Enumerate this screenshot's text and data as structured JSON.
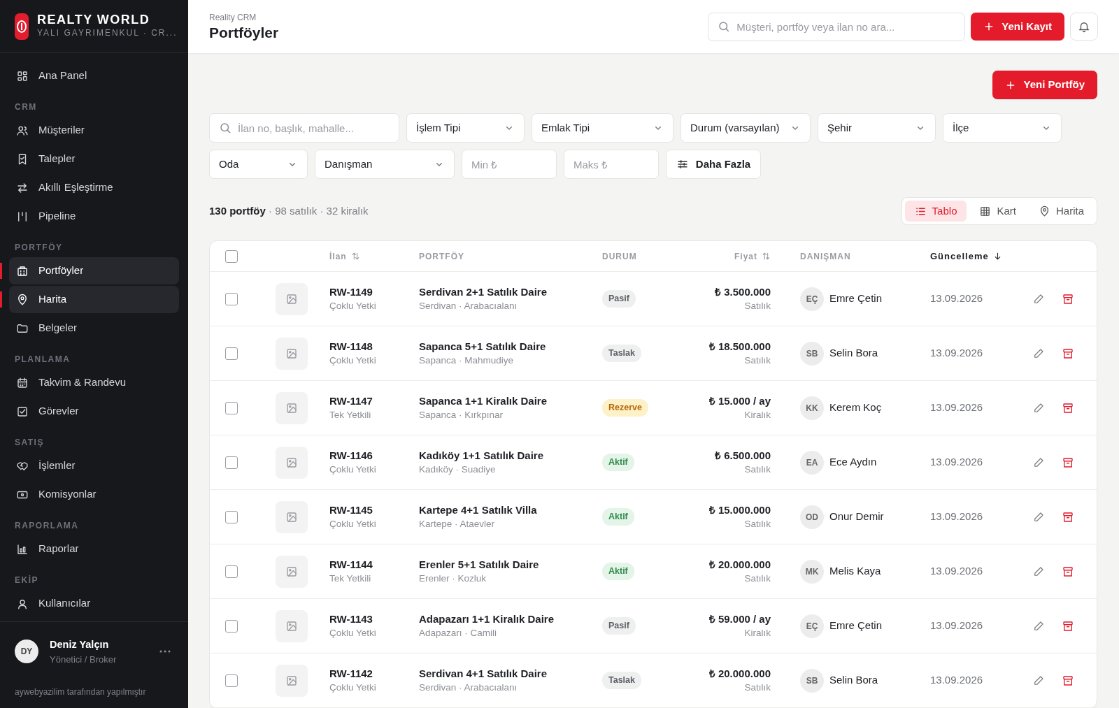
{
  "brand": {
    "title": "REALTY WORLD",
    "subtitle": "YALI GAYRIMENKUL · CR..."
  },
  "sidebar": {
    "sections": [
      {
        "items": [
          {
            "label": "Ana Panel",
            "selected": false
          }
        ]
      },
      {
        "label": "CRM",
        "items": [
          {
            "label": "Müşteriler",
            "selected": false
          },
          {
            "label": "Talepler",
            "selected": false
          },
          {
            "label": "Akıllı Eşleştirme",
            "selected": false
          },
          {
            "label": "Pipeline",
            "selected": false
          }
        ]
      },
      {
        "label": "PORTFÖY",
        "items": [
          {
            "label": "Portföyler",
            "selected": true
          },
          {
            "label": "Harita",
            "selected": true
          },
          {
            "label": "Belgeler",
            "selected": false
          }
        ]
      },
      {
        "label": "PLANLAMA",
        "items": [
          {
            "label": "Takvim & Randevu",
            "selected": false
          },
          {
            "label": "Görevler",
            "selected": false
          }
        ]
      },
      {
        "label": "SATIŞ",
        "items": [
          {
            "label": "İşlemler",
            "selected": false
          },
          {
            "label": "Komisyonlar",
            "selected": false
          }
        ]
      },
      {
        "label": "RAPORLAMA",
        "items": [
          {
            "label": "Raporlar",
            "selected": false
          }
        ]
      },
      {
        "label": "EKİP",
        "items": [
          {
            "label": "Kullanıcılar",
            "selected": false
          }
        ]
      }
    ],
    "user": {
      "initials": "DY",
      "name": "Deniz Yalçın",
      "role": "Yönetici / Broker"
    },
    "credit": "aywebyazilim tarafından yapılmıştır"
  },
  "header": {
    "breadcrumb": "Reality CRM",
    "title": "Portföyler",
    "search": {
      "placeholder": "Müşteri, portföy veya ilan no ara..."
    },
    "new_button": "Yeni Kayıt"
  },
  "new_portfolio_button": "Yeni Portföy",
  "filters": [
    {
      "kind": "search",
      "placeholder": "İlan no, başlık, mahalle..."
    },
    {
      "kind": "select",
      "value": "İşlem Tipi"
    },
    {
      "kind": "select",
      "value": "Emlak Tipi"
    },
    {
      "kind": "select",
      "value": "Durum (varsayılan)"
    },
    {
      "kind": "select",
      "value": "Şehir"
    },
    {
      "kind": "select",
      "value": "İlçe"
    },
    {
      "kind": "select",
      "value": "Oda"
    },
    {
      "kind": "select",
      "value": "Danışman"
    },
    {
      "kind": "input",
      "placeholder": "Min ₺"
    },
    {
      "kind": "input",
      "placeholder": "Maks ₺"
    },
    {
      "kind": "button",
      "label": "Daha Fazla"
    }
  ],
  "summary": "**130 portföy** · 98 satılık · 32 kiralık",
  "views": [
    {
      "label": "Tablo",
      "selected": true
    },
    {
      "label": "Kart",
      "selected": false
    },
    {
      "label": "Harita",
      "selected": false
    }
  ],
  "table": {
    "header_checkbox": {
      "checked": false
    },
    "columns": [
      {
        "label": "İlan",
        "sortable": true,
        "sorted": false
      },
      {
        "label": "PORTFÖY",
        "sortable": false,
        "sorted": false
      },
      {
        "label": "DURUM",
        "sortable": false,
        "sorted": false
      },
      {
        "label": "Fiyat",
        "sortable": true,
        "sorted": false
      },
      {
        "label": "DANIŞMAN",
        "sortable": false,
        "sorted": false
      },
      {
        "label": "Güncelleme",
        "sortable": true,
        "sorted": true
      }
    ],
    "rows": [
      {
        "checked": false,
        "id": "RW-1149",
        "auth": "Çoklu Yetki",
        "title": "Serdivan 2+1 Satılık Daire",
        "location": "Serdivan · Arabacıalanı",
        "status": {
          "label": "Pasif",
          "kind": "neutral"
        },
        "price": "₺ 3.500.000",
        "type": "Satılık",
        "initials": "EÇ",
        "agent": "Emre Çetin",
        "updated": "13.09.2026"
      },
      {
        "checked": false,
        "id": "RW-1148",
        "auth": "Çoklu Yetki",
        "title": "Sapanca 5+1 Satılık Daire",
        "location": "Sapanca · Mahmudiye",
        "status": {
          "label": "Taslak",
          "kind": "neutral"
        },
        "price": "₺ 18.500.000",
        "type": "Satılık",
        "initials": "SB",
        "agent": "Selin Bora",
        "updated": "13.09.2026"
      },
      {
        "checked": false,
        "id": "RW-1147",
        "auth": "Tek Yetkili",
        "title": "Sapanca 1+1 Kiralık Daire",
        "location": "Sapanca · Kırkpınar",
        "status": {
          "label": "Rezerve",
          "kind": "warning"
        },
        "price": "₺ 15.000 / ay",
        "type": "Kiralık",
        "initials": "KK",
        "agent": "Kerem Koç",
        "updated": "13.09.2026"
      },
      {
        "checked": false,
        "id": "RW-1146",
        "auth": "Çoklu Yetki",
        "title": "Kadıköy 1+1 Satılık Daire",
        "location": "Kadıköy · Suadiye",
        "status": {
          "label": "Aktif",
          "kind": "success"
        },
        "price": "₺ 6.500.000",
        "type": "Satılık",
        "initials": "EA",
        "agent": "Ece Aydın",
        "updated": "13.09.2026"
      },
      {
        "checked": false,
        "id": "RW-1145",
        "auth": "Çoklu Yetki",
        "title": "Kartepe 4+1 Satılık Villa",
        "location": "Kartepe · Ataevler",
        "status": {
          "label": "Aktif",
          "kind": "success"
        },
        "price": "₺ 15.000.000",
        "type": "Satılık",
        "initials": "OD",
        "agent": "Onur Demir",
        "updated": "13.09.2026"
      },
      {
        "checked": false,
        "id": "RW-1144",
        "auth": "Tek Yetkili",
        "title": "Erenler 5+1 Satılık Daire",
        "location": "Erenler · Kozluk",
        "status": {
          "label": "Aktif",
          "kind": "success"
        },
        "price": "₺ 20.000.000",
        "type": "Satılık",
        "initials": "MK",
        "agent": "Melis Kaya",
        "updated": "13.09.2026"
      },
      {
        "checked": false,
        "id": "RW-1143",
        "auth": "Çoklu Yetki",
        "title": "Adapazarı 1+1 Kiralık Daire",
        "location": "Adapazarı · Camili",
        "status": {
          "label": "Pasif",
          "kind": "neutral"
        },
        "price": "₺ 59.000 / ay",
        "type": "Kiralık",
        "initials": "EÇ",
        "agent": "Emre Çetin",
        "updated": "13.09.2026"
      },
      {
        "checked": false,
        "id": "RW-1142",
        "auth": "Çoklu Yetki",
        "title": "Serdivan 4+1 Satılık Daire",
        "location": "Serdivan · Arabacıalanı",
        "status": {
          "label": "Taslak",
          "kind": "neutral"
        },
        "price": "₺ 20.000.000",
        "type": "Satılık",
        "initials": "SB",
        "agent": "Selin Bora",
        "updated": "13.09.2026"
      }
    ]
  }
}
